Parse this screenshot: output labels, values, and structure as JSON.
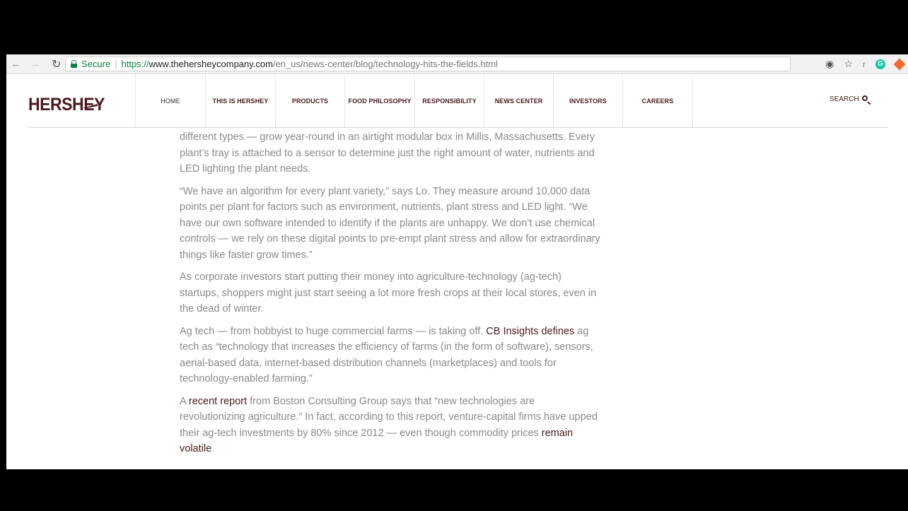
{
  "browser": {
    "secure_label": "Secure",
    "url_scheme": "https://",
    "url_host": "www.thehersheycompany.com",
    "url_path": "/en_us/news-center/blog/technology-hits-the-fields.html",
    "icons": [
      "back-icon",
      "forward-icon",
      "reload-icon",
      "lock-icon",
      "location-icon",
      "star-icon",
      "extension-r-icon",
      "grammarly-icon",
      "extension-orange-icon"
    ],
    "ext_r_label": "r",
    "ext_g_label": "G"
  },
  "header": {
    "logo": "HERSHEY",
    "nav": [
      "HOME",
      "THIS IS HERSHEY",
      "PRODUCTS",
      "FOOD PHILOSOPHY",
      "RESPONSIBILITY",
      "NEWS CENTER",
      "INVESTORS",
      "CAREERS"
    ],
    "search_label": "SEARCH"
  },
  "article": {
    "p1": "different types — grow year-round in an airtight modular box in Millis, Massachusetts. Every plant’s tray is attached to a sensor to determine just the right amount of water, nutrients and LED lighting the plant needs.",
    "p2": "“We have an algorithm for every plant variety,” says Lo. They measure around 10,000 data points per plant for factors such as environment, nutrients, plant stress and LED light. “We have our own software intended to identify if the plants are unhappy. We don’t use chemical controls — we rely on these digital points to pre-empt plant stress and allow for extraordinary things like faster grow times.”",
    "p3": "As corporate investors start putting their money into agriculture-technology (ag-tech) startups, shoppers might just start seeing a lot more fresh crops at their local stores, even in the dead of winter.",
    "p4_before": "Ag tech — from hobbyist to huge commercial farms — is taking off. ",
    "p4_link": "CB Insights defines",
    "p4_after": " ag tech as “technology that increases the efficiency of farms (in the form of software), sensors, aerial-based data, internet-based distribution channels (marketplaces) and tools for technology-enabled farming.”",
    "p5_before": "A ",
    "p5_link1": "recent report",
    "p5_mid": " from Boston Consulting Group says that “new technologies are revolutionizing agriculture.” In fact, according to this report, venture-capital firms have upped their ag-tech investments by 80% since 2012 — even though commodity prices ",
    "p5_link2": "remain volatile",
    "p5_end": "."
  }
}
